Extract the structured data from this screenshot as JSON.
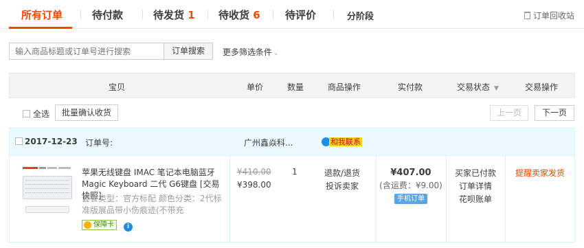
{
  "tabs": [
    {
      "label": "所有订单",
      "count": ""
    },
    {
      "label": "待付款",
      "count": ""
    },
    {
      "label": "待发货",
      "count": "1"
    },
    {
      "label": "待收货",
      "count": "6"
    },
    {
      "label": "待评价",
      "count": ""
    },
    {
      "label": "分阶段",
      "count": ""
    }
  ],
  "recycle_label": "订单回收站",
  "search": {
    "placeholder": "输入商品标题或订单号进行搜索",
    "button": "订单搜索",
    "more_filters": "更多筛选条件"
  },
  "table_header": {
    "item": "宝贝",
    "unit_price": "单价",
    "quantity": "数量",
    "item_ops": "商品操作",
    "paid": "实付款",
    "status": "交易状态",
    "actions": "交易操作"
  },
  "batch": {
    "select_all": "全选",
    "confirm_receipt": "批量确认收货",
    "prev_page": "上一页",
    "next_page": "下一页"
  },
  "order": {
    "date": "2017-12-23",
    "order_no_label": "订单号:",
    "shop": "广州鑫焱科...",
    "contact": "和我联系",
    "item": {
      "title": "苹果无线键盘 IMAC 笔记本电脑蓝牙 Magic Keyboard 二代 G6键盘 [交易快照]",
      "spec": "套餐类型：官方标配  颜色分类：2代标准版展品带小伤痕迹(不带充",
      "guarantee": "保障卡",
      "info": "i",
      "original_price": "¥410.00",
      "price": "¥398.00",
      "quantity": "1",
      "op_refund": "退款/退货",
      "op_complain": "投诉卖家"
    },
    "paid_amount": "¥407.00",
    "shipping": "(含运费：¥9.00)",
    "mobile_tag": "手机订单",
    "status_text": "买家已付款",
    "detail_link": "订单详情",
    "huabei_link": "花呗账单",
    "action": "提醒卖家发货"
  }
}
